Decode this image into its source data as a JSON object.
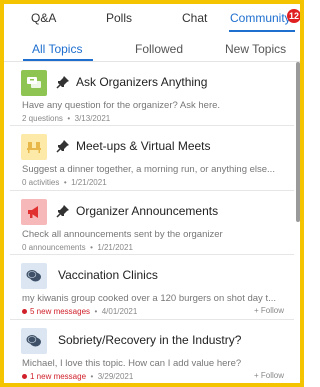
{
  "top_nav": {
    "tabs": [
      {
        "label": "Q&A"
      },
      {
        "label": "Polls"
      },
      {
        "label": "Chat"
      },
      {
        "label": "Community"
      }
    ],
    "community_badge": "12",
    "active": "Community"
  },
  "sub_tabs": {
    "tabs": [
      {
        "label": "All Topics"
      },
      {
        "label": "Followed"
      },
      {
        "label": "New Topics"
      }
    ],
    "active": "All Topics"
  },
  "topics": [
    {
      "title": "Ask Organizers Anything",
      "description": "Have any question for the organizer? Ask here.",
      "count": "2 questions",
      "date": "3/13/2021",
      "pinned": true,
      "icon": "question-chat-icon",
      "icon_bg": "#8dc452"
    },
    {
      "title": "Meet-ups & Virtual Meets",
      "description": "Suggest a dinner together, a morning run, or anything else...",
      "count": "0 activities",
      "date": "1/21/2021",
      "pinned": true,
      "icon": "meetup-chairs-icon",
      "icon_bg": "#fde9a8"
    },
    {
      "title": "Organizer Announcements",
      "description": "Check all announcements sent by the organizer",
      "count": "0 announcements",
      "date": "1/21/2021",
      "pinned": true,
      "icon": "megaphone-icon",
      "icon_bg": "#f6b8b8"
    },
    {
      "title": "Vaccination Clinics",
      "description": "my kiwanis group cooked over a 120 burgers on shot day t...",
      "count": "5 new messages",
      "date": "4/01/2021",
      "pinned": false,
      "icon": "chat-bubbles-icon",
      "icon_bg": "#dbe6f2",
      "follow": "Follow"
    },
    {
      "title": "Sobriety/Recovery in the Industry?",
      "description": "Michael, I love this topic. How can I add value here?",
      "count": "1 new message",
      "date": "3/29/2021",
      "pinned": false,
      "icon": "chat-bubbles-icon",
      "icon_bg": "#dbe6f2",
      "follow": "Follow"
    }
  ],
  "colors": {
    "accent": "#1f6fcf",
    "frame": "#f5c400",
    "badge": "#e02020",
    "unread": "#d0202a"
  }
}
